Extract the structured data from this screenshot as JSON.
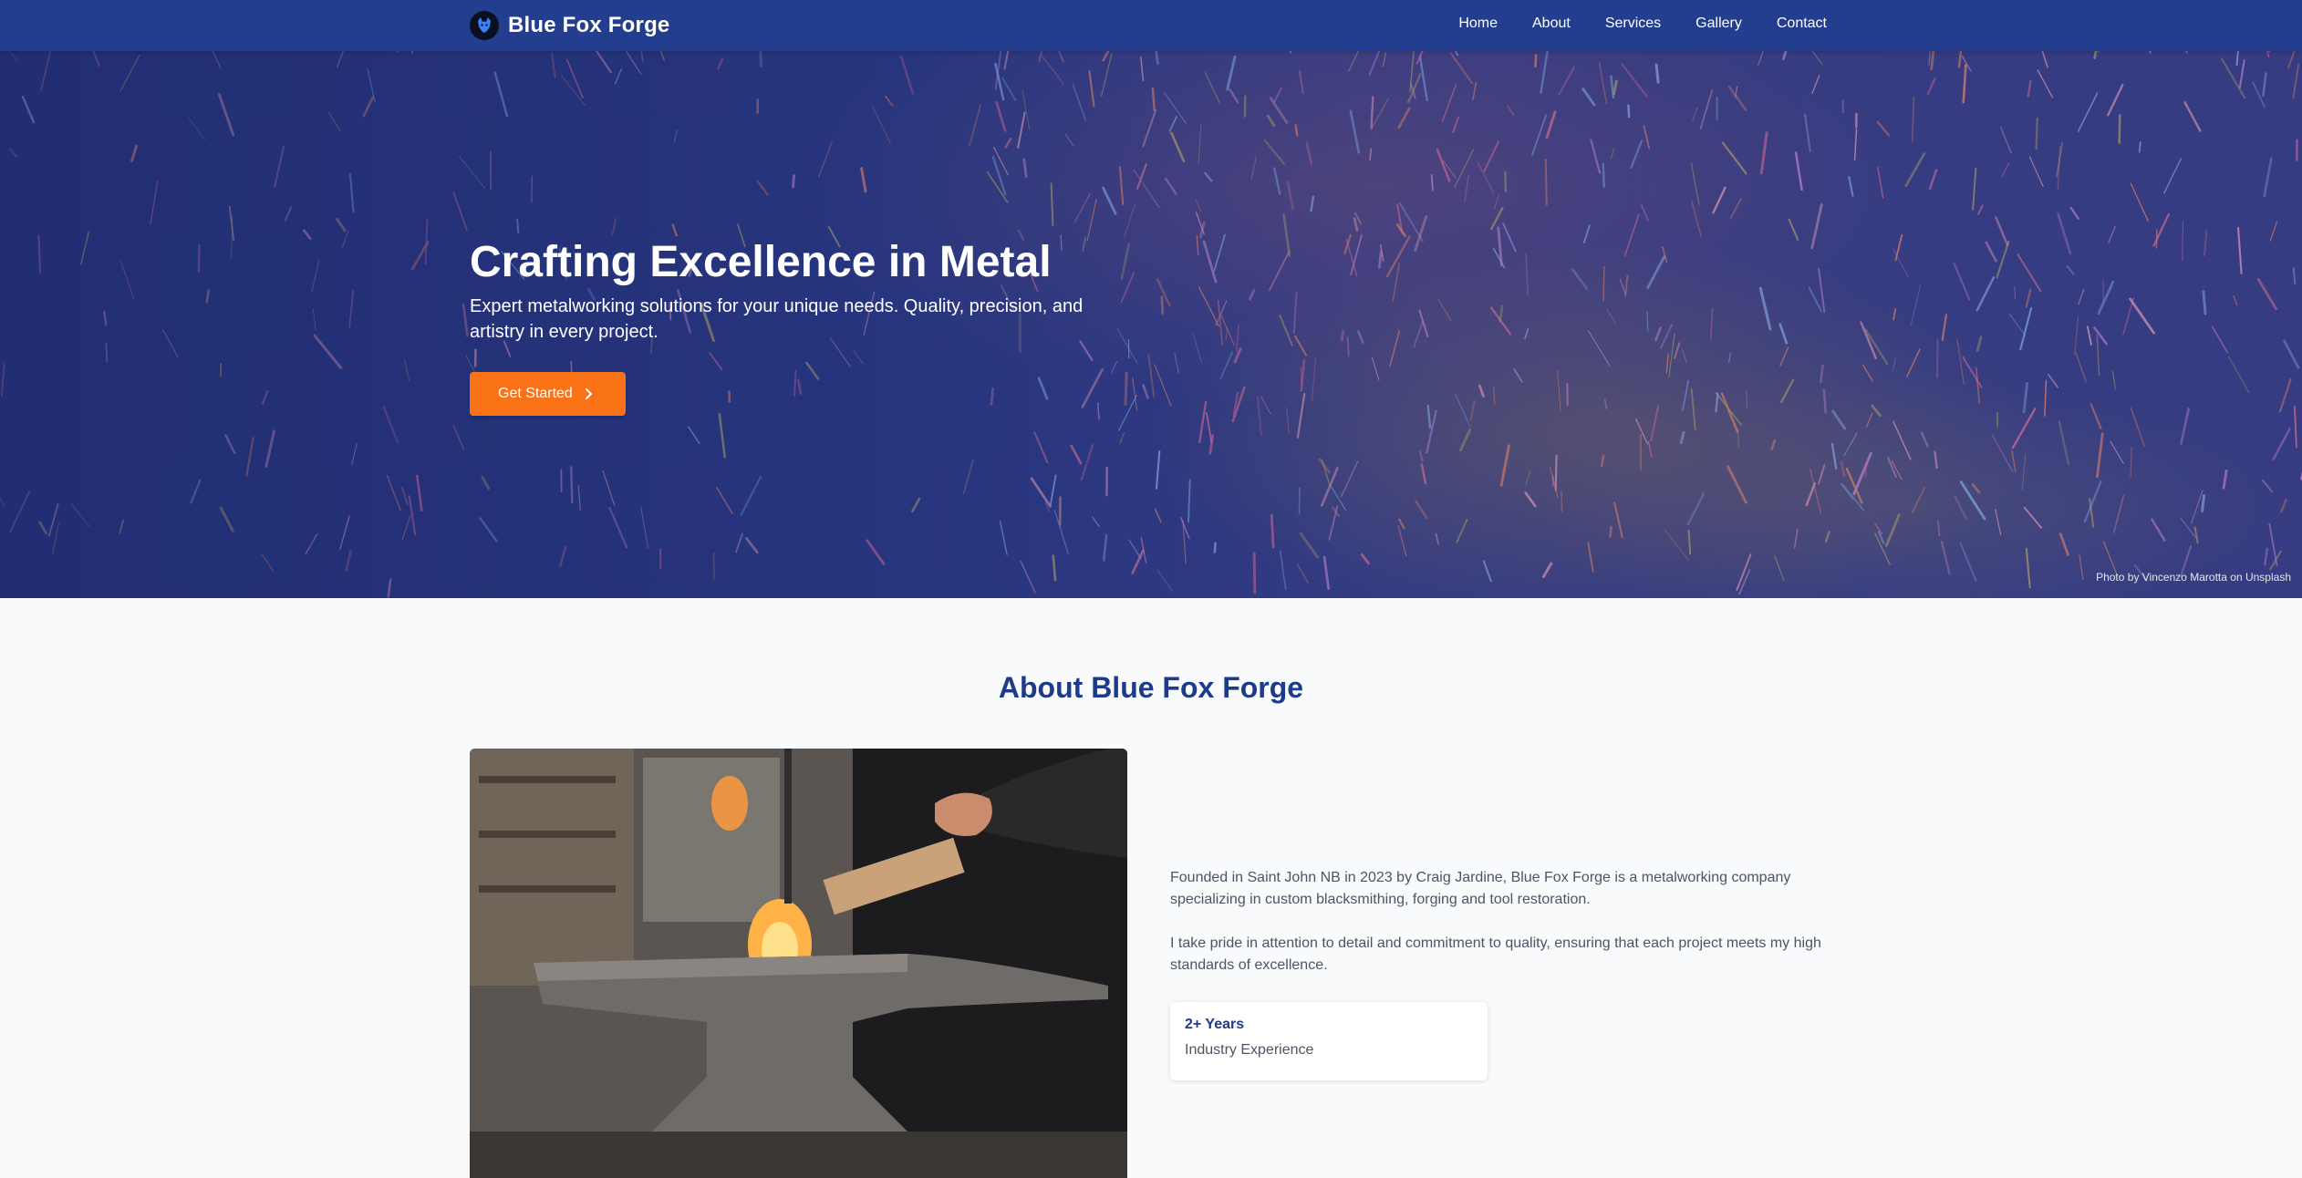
{
  "brand": {
    "name": "Blue Fox Forge",
    "logo_icon": "fox-logo-icon"
  },
  "nav": {
    "links": [
      {
        "label": "Home"
      },
      {
        "label": "About"
      },
      {
        "label": "Services"
      },
      {
        "label": "Gallery"
      },
      {
        "label": "Contact"
      }
    ]
  },
  "hero": {
    "title": "Crafting Excellence in Metal",
    "subtitle": "Expert metalworking solutions for your unique needs. Quality, precision, and artistry in every project.",
    "cta_label": "Get Started",
    "cta_icon": "chevron-right-icon",
    "photo_credit": "Photo by Vincenzo Marotta on Unsplash"
  },
  "about": {
    "title": "About Blue Fox Forge",
    "paragraphs": [
      "Founded in Saint John NB in 2023 by Craig Jardine, Blue Fox Forge is a metalworking company specializing in custom blacksmithing, forging and tool restoration.",
      "I take pride in attention to detail and commitment to quality, ensuring that each project meets my high standards of excellence."
    ],
    "stat": {
      "value": "2+ Years",
      "label": "Industry Experience"
    }
  },
  "colors": {
    "nav_bg": "#233d8f",
    "accent": "#f97316",
    "heading": "#1e3a8a",
    "page_bg": "#f8fafc"
  }
}
